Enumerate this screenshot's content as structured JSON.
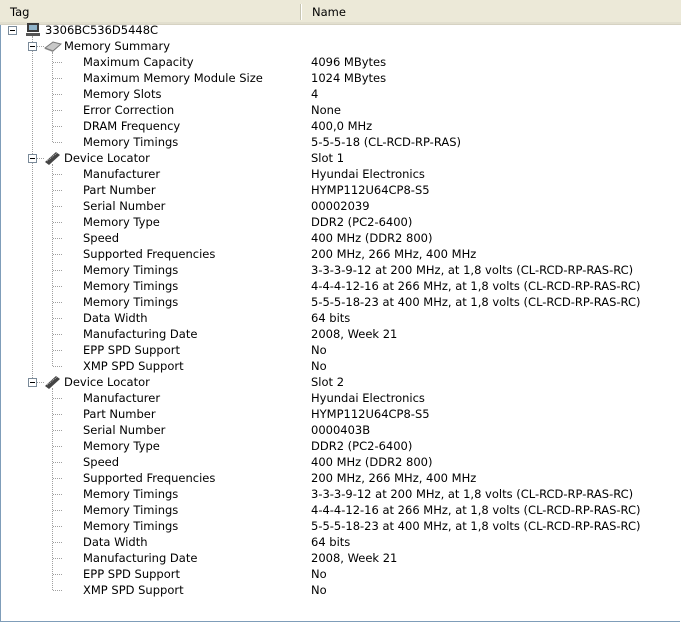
{
  "header": {
    "tag": "Tag",
    "name": "Name"
  },
  "root": {
    "label": "3306BC536D5448C",
    "icon": "computer-icon",
    "groups": [
      {
        "label": "Memory Summary",
        "value": "",
        "icon": "memory-summary-icon",
        "items": [
          {
            "tag": "Maximum Capacity",
            "value": "4096 MBytes"
          },
          {
            "tag": "Maximum Memory Module Size",
            "value": "1024 MBytes"
          },
          {
            "tag": "Memory Slots",
            "value": "4"
          },
          {
            "tag": "Error Correction",
            "value": "None"
          },
          {
            "tag": "DRAM Frequency",
            "value": "400,0 MHz"
          },
          {
            "tag": "Memory Timings",
            "value": "5-5-5-18 (CL-RCD-RP-RAS)"
          }
        ]
      },
      {
        "label": "Device Locator",
        "value": "Slot 1",
        "icon": "memory-module-icon",
        "items": [
          {
            "tag": "Manufacturer",
            "value": "Hyundai Electronics"
          },
          {
            "tag": "Part Number",
            "value": "HYMP112U64CP8-S5"
          },
          {
            "tag": "Serial Number",
            "value": "00002039"
          },
          {
            "tag": "Memory Type",
            "value": "DDR2 (PC2-6400)"
          },
          {
            "tag": "Speed",
            "value": "400 MHz (DDR2 800)"
          },
          {
            "tag": "Supported Frequencies",
            "value": "200 MHz, 266 MHz, 400 MHz"
          },
          {
            "tag": "Memory Timings",
            "value": "3-3-3-9-12 at 200 MHz, at 1,8 volts (CL-RCD-RP-RAS-RC)"
          },
          {
            "tag": "Memory Timings",
            "value": "4-4-4-12-16 at 266 MHz, at 1,8 volts (CL-RCD-RP-RAS-RC)"
          },
          {
            "tag": "Memory Timings",
            "value": "5-5-5-18-23 at 400 MHz, at 1,8 volts (CL-RCD-RP-RAS-RC)"
          },
          {
            "tag": "Data Width",
            "value": "64 bits"
          },
          {
            "tag": "Manufacturing Date",
            "value": "2008, Week 21"
          },
          {
            "tag": "EPP SPD Support",
            "value": "No"
          },
          {
            "tag": "XMP SPD Support",
            "value": "No"
          }
        ]
      },
      {
        "label": "Device Locator",
        "value": "Slot 2",
        "icon": "memory-module-icon",
        "items": [
          {
            "tag": "Manufacturer",
            "value": "Hyundai Electronics"
          },
          {
            "tag": "Part Number",
            "value": "HYMP112U64CP8-S5"
          },
          {
            "tag": "Serial Number",
            "value": "0000403B"
          },
          {
            "tag": "Memory Type",
            "value": "DDR2 (PC2-6400)"
          },
          {
            "tag": "Speed",
            "value": "400 MHz (DDR2 800)"
          },
          {
            "tag": "Supported Frequencies",
            "value": "200 MHz, 266 MHz, 400 MHz"
          },
          {
            "tag": "Memory Timings",
            "value": "3-3-3-9-12 at 200 MHz, at 1,8 volts (CL-RCD-RP-RAS-RC)"
          },
          {
            "tag": "Memory Timings",
            "value": "4-4-4-12-16 at 266 MHz, at 1,8 volts (CL-RCD-RP-RAS-RC)"
          },
          {
            "tag": "Memory Timings",
            "value": "5-5-5-18-23 at 400 MHz, at 1,8 volts (CL-RCD-RP-RAS-RC)"
          },
          {
            "tag": "Data Width",
            "value": "64 bits"
          },
          {
            "tag": "Manufacturing Date",
            "value": "2008, Week 21"
          },
          {
            "tag": "EPP SPD Support",
            "value": "No"
          },
          {
            "tag": "XMP SPD Support",
            "value": "No"
          }
        ]
      }
    ]
  }
}
